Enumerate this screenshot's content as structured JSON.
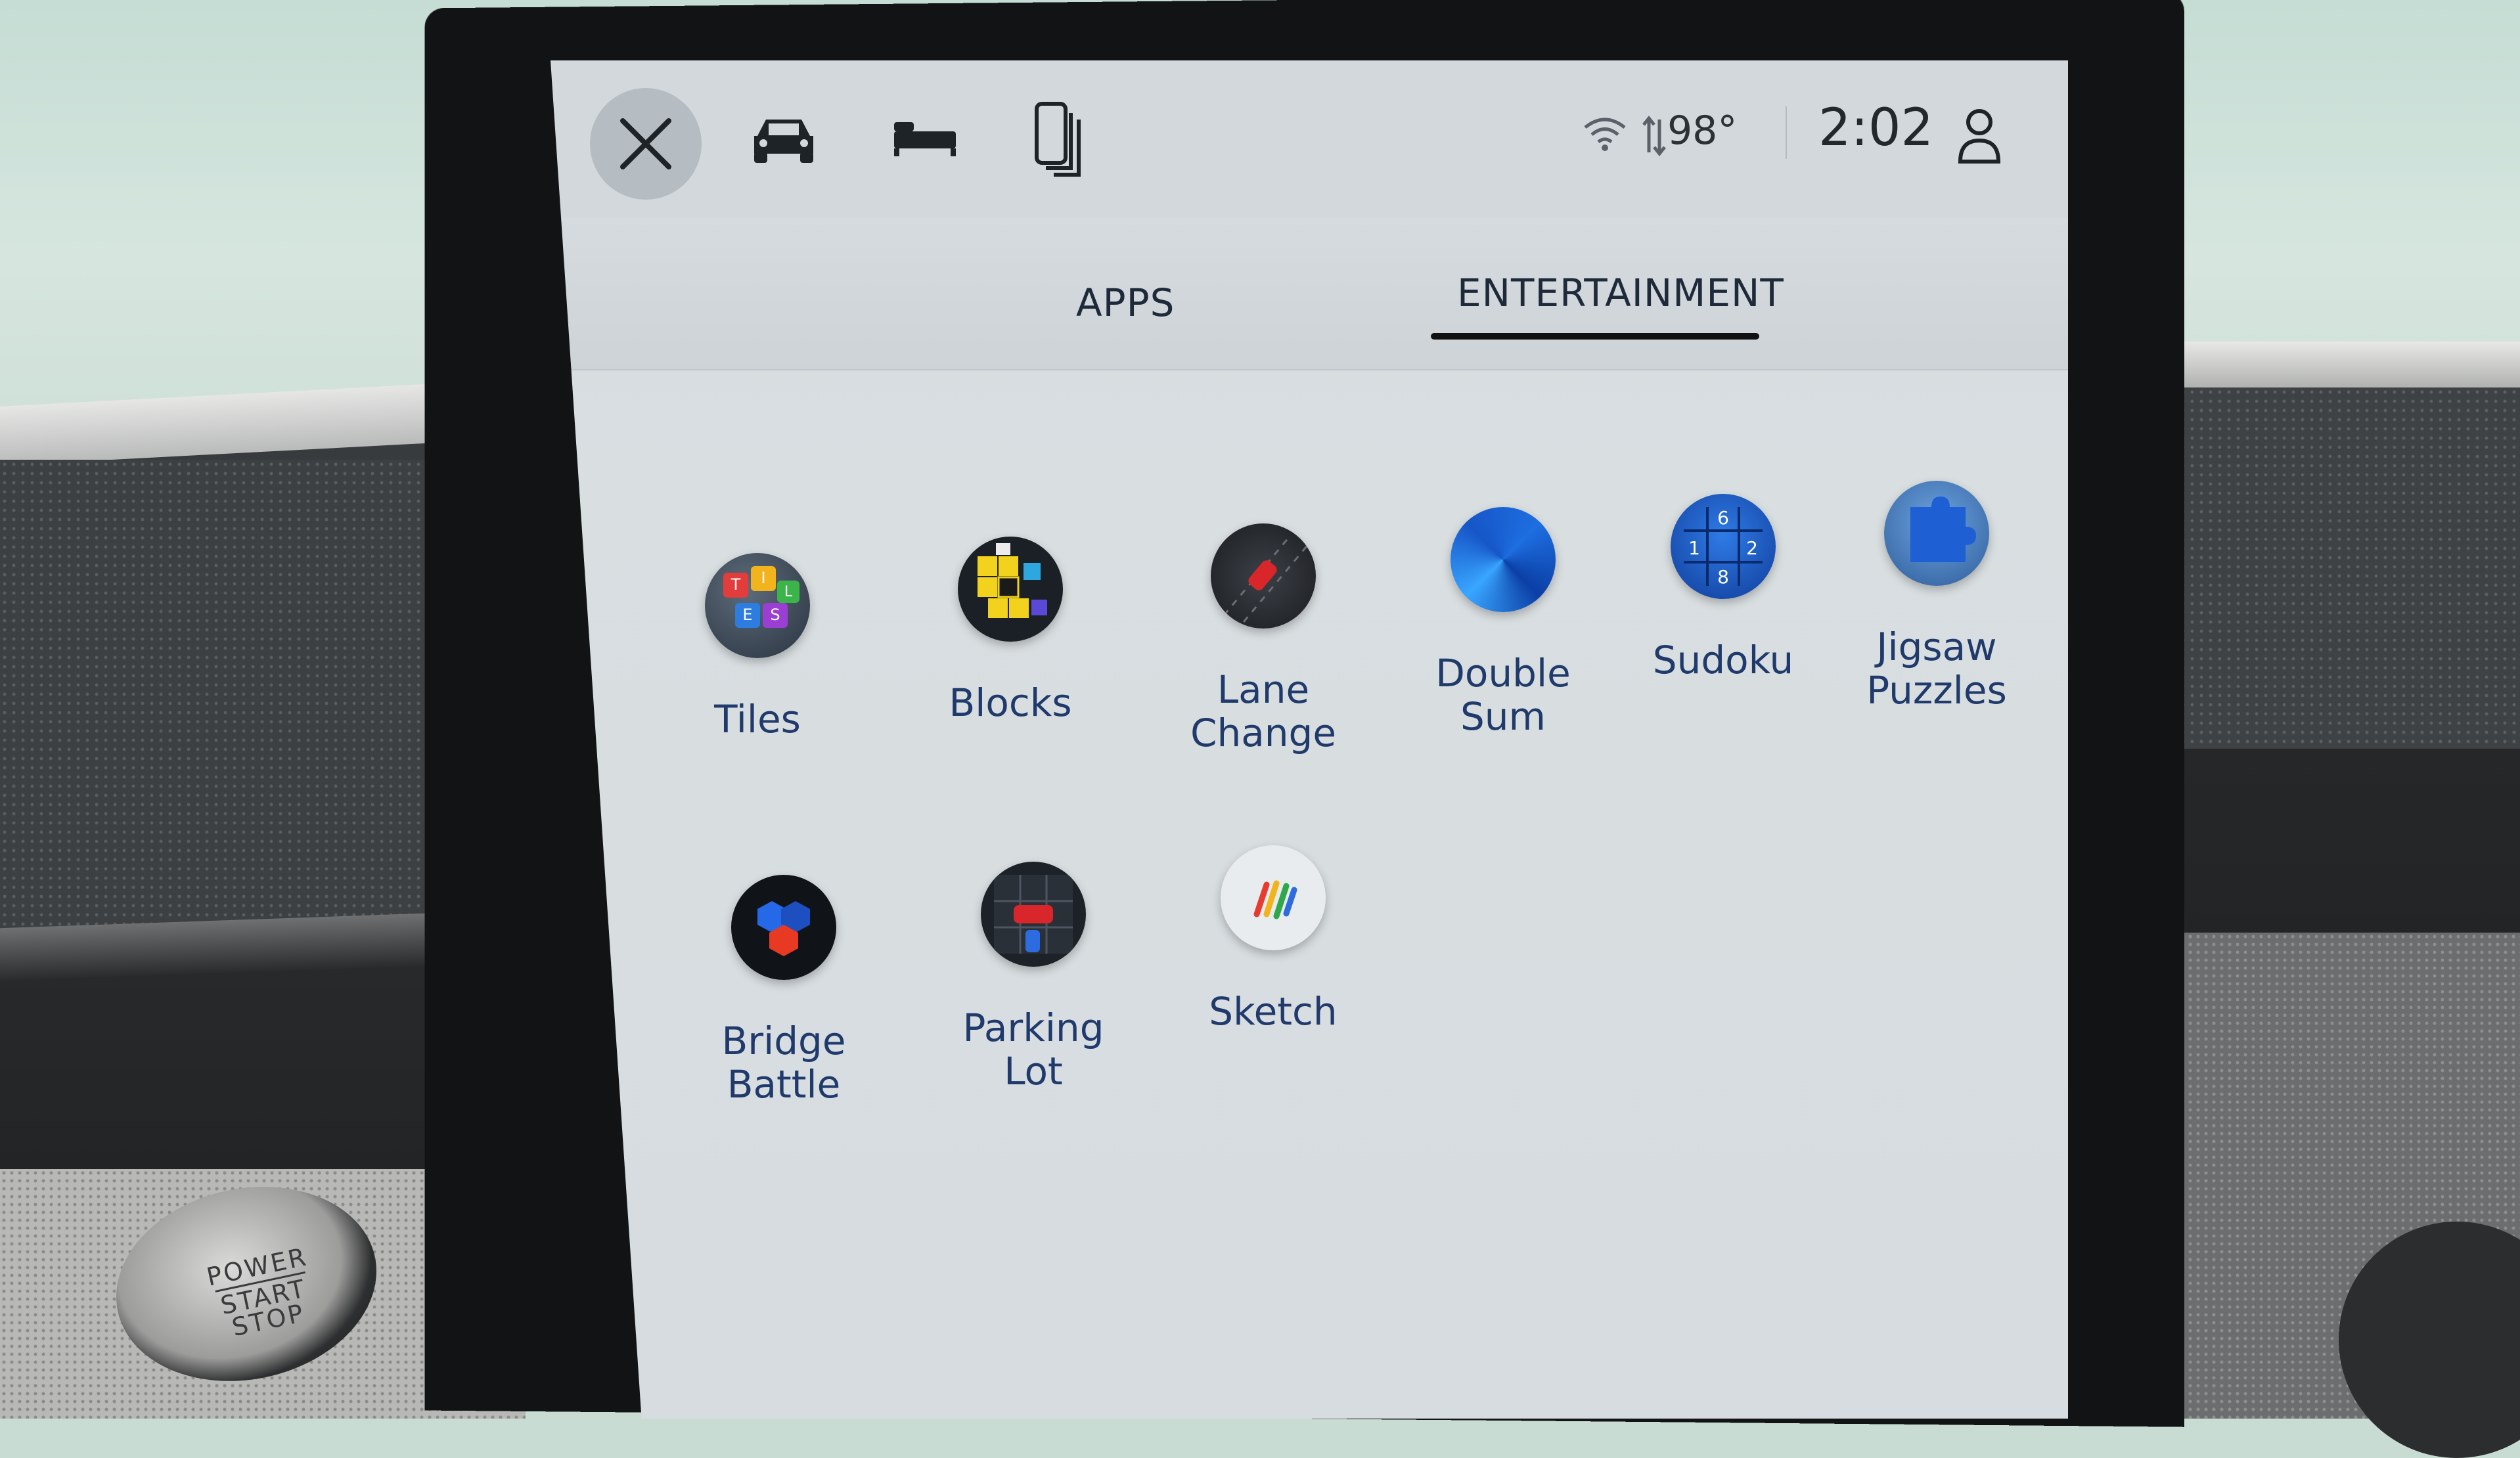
{
  "statusbar": {
    "temperature": "98°",
    "time": "2:02",
    "icons": [
      "close-icon",
      "car-icon",
      "bed-icon",
      "phone-icon",
      "wifi-icon",
      "data-transfer-icon",
      "user-icon"
    ]
  },
  "tabs": [
    {
      "label": "APPS",
      "active": false
    },
    {
      "label": "ENTERTAINMENT",
      "active": true
    }
  ],
  "apps": [
    {
      "label": "Tiles",
      "icon": "tiles-icon"
    },
    {
      "label": "Blocks",
      "icon": "blocks-icon"
    },
    {
      "label": "Lane Change",
      "icon": "lane-change-icon"
    },
    {
      "label": "Double Sum",
      "icon": "double-sum-icon"
    },
    {
      "label": "Sudoku",
      "icon": "sudoku-icon"
    },
    {
      "label": "Jigsaw Puzzles",
      "icon": "jigsaw-puzzles-icon"
    },
    {
      "label": "Bridge Battle",
      "icon": "bridge-battle-icon"
    },
    {
      "label": "Parking Lot",
      "icon": "parking-lot-icon"
    },
    {
      "label": "Sketch",
      "icon": "sketch-icon"
    }
  ],
  "tile_letters": [
    "T",
    "I",
    "L",
    "E",
    "S"
  ],
  "sudoku_digits": [
    "6",
    "1",
    "2",
    "8"
  ],
  "power_button": {
    "line1": "POWER",
    "line2": "START",
    "line3": "STOP"
  },
  "colors": {
    "accent_underline": "#111111",
    "label_text": "#1f3a6b",
    "screen_bg": "#d6dce0"
  }
}
